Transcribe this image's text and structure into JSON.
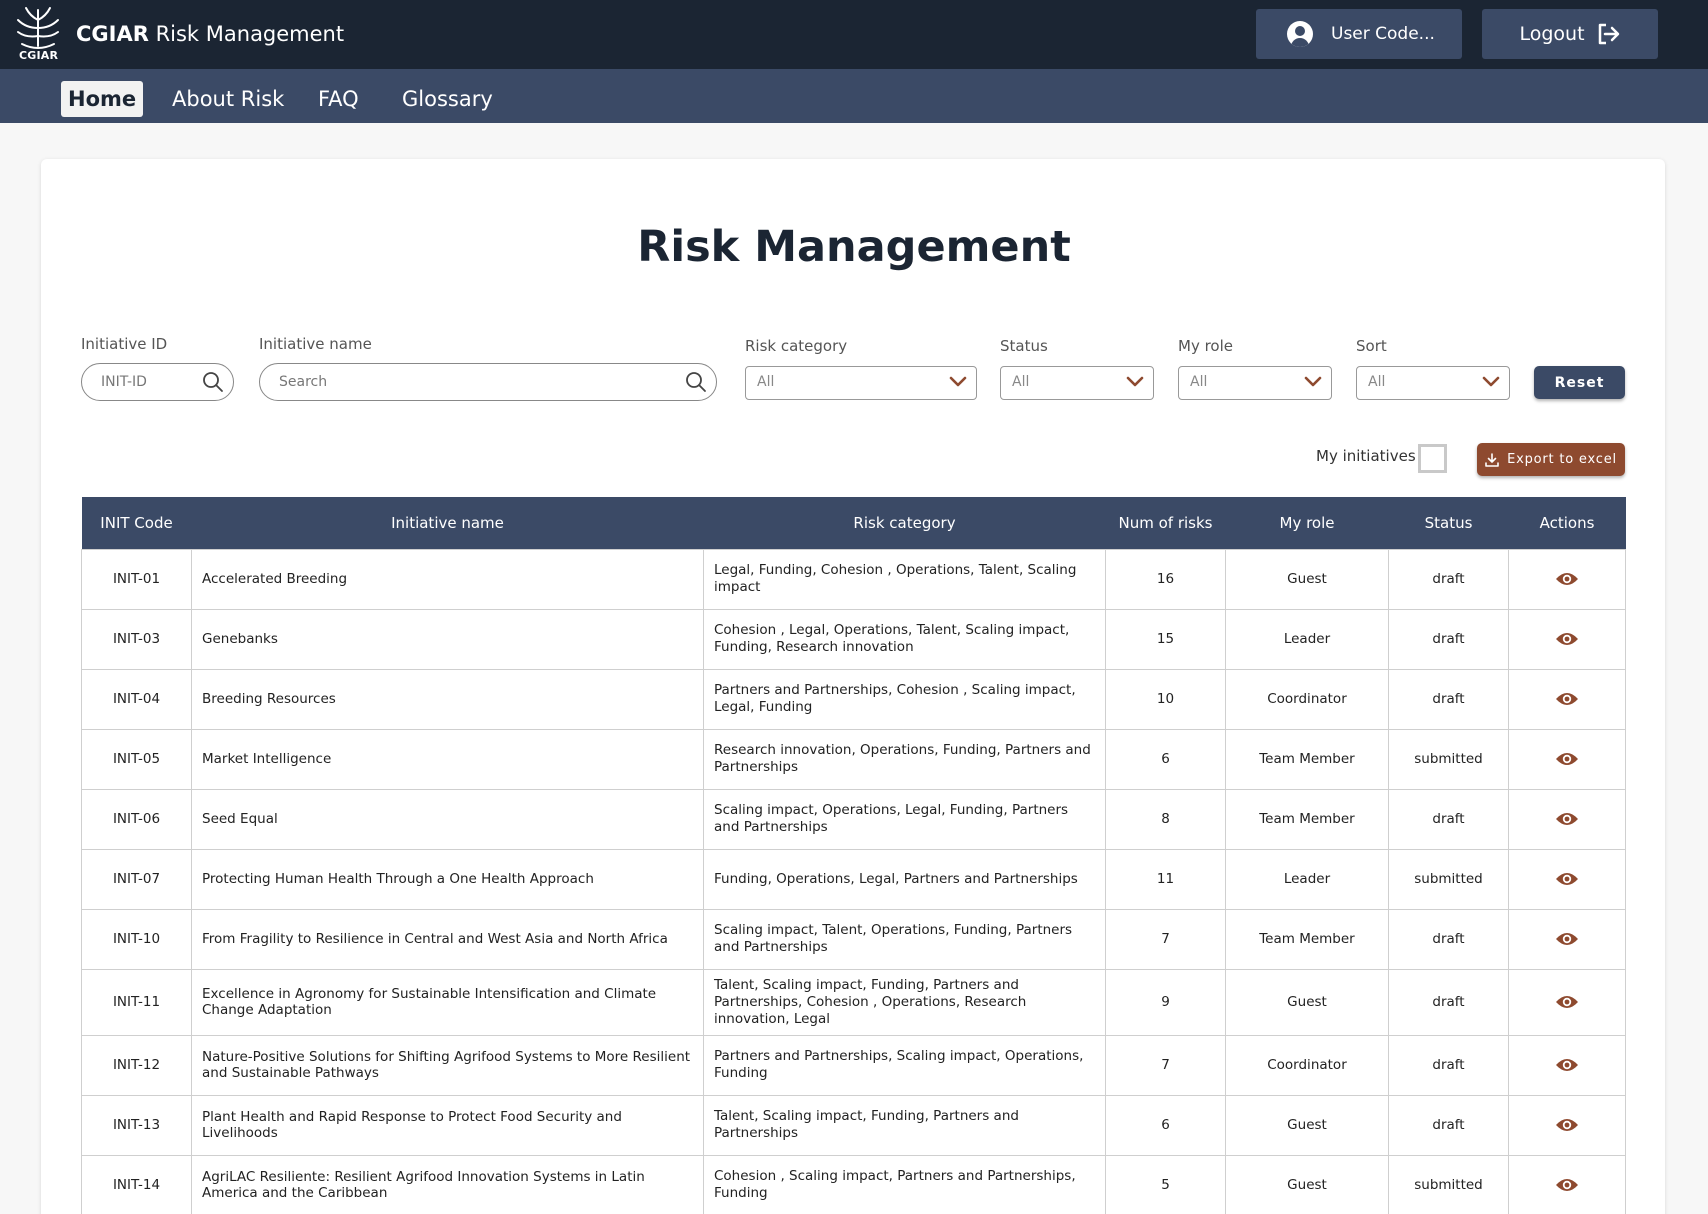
{
  "header": {
    "logo_text": "CGIAR",
    "title_bold": "CGIAR",
    "title_rest": " Risk Management",
    "user_label": "User Code...",
    "logout_label": "Logout"
  },
  "nav": {
    "items": [
      {
        "label": "Home",
        "active": true
      },
      {
        "label": "About Risk",
        "active": false
      },
      {
        "label": "FAQ",
        "active": false
      },
      {
        "label": "Glossary",
        "active": false
      }
    ]
  },
  "page": {
    "title": "Risk Management"
  },
  "filters": {
    "initiative_id": {
      "label": "Initiative ID",
      "placeholder": "INIT-ID"
    },
    "initiative_name": {
      "label": "Initiative name",
      "placeholder": "Search"
    },
    "risk_category": {
      "label": "Risk category",
      "value": "All"
    },
    "status": {
      "label": "Status",
      "value": "All"
    },
    "my_role": {
      "label": "My role",
      "value": "All"
    },
    "sort": {
      "label": "Sort",
      "value": "All"
    },
    "reset_label": "Reset",
    "my_initiatives_label": "My initiatives",
    "export_label": "Export to excel"
  },
  "table": {
    "headers": [
      "INIT Code",
      "Initiative name",
      "Risk category",
      "Num of risks",
      "My role",
      "Status",
      "Actions"
    ],
    "rows": [
      {
        "code": "INIT-01",
        "name": "Accelerated Breeding",
        "risk": "Legal, Funding, Cohesion , Operations, Talent, Scaling impact",
        "num": "16",
        "role": "Guest",
        "status": "draft"
      },
      {
        "code": "INIT-03",
        "name": "Genebanks",
        "risk": "Cohesion , Legal, Operations, Talent, Scaling impact, Funding, Research innovation",
        "num": "15",
        "role": "Leader",
        "status": "draft"
      },
      {
        "code": "INIT-04",
        "name": "Breeding Resources",
        "risk": "Partners and Partnerships, Cohesion , Scaling impact, Legal, Funding",
        "num": "10",
        "role": "Coordinator",
        "status": "draft"
      },
      {
        "code": "INIT-05",
        "name": "Market Intelligence",
        "risk": "Research innovation, Operations, Funding, Partners and Partnerships",
        "num": "6",
        "role": "Team Member",
        "status": "submitted"
      },
      {
        "code": "INIT-06",
        "name": "Seed Equal",
        "risk": "Scaling impact, Operations, Legal, Funding, Partners and Partnerships",
        "num": "8",
        "role": "Team Member",
        "status": "draft"
      },
      {
        "code": "INIT-07",
        "name": "Protecting Human Health Through a One Health Approach",
        "risk": "Funding, Operations, Legal, Partners and Partnerships",
        "num": "11",
        "role": "Leader",
        "status": "submitted"
      },
      {
        "code": "INIT-10",
        "name": "From Fragility to Resilience in Central and West Asia and North Africa",
        "risk": "Scaling impact, Talent, Operations, Funding, Partners and Partnerships",
        "num": "7",
        "role": "Team Member",
        "status": "draft"
      },
      {
        "code": "INIT-11",
        "name": "Excellence in Agronomy for Sustainable Intensification and Climate Change Adaptation",
        "risk": "Talent, Scaling impact, Funding, Partners and Partnerships, Cohesion , Operations, Research innovation, Legal",
        "num": "9",
        "role": "Guest",
        "status": "draft"
      },
      {
        "code": "INIT-12",
        "name": "Nature-Positive Solutions for Shifting Agrifood Systems to More Resilient and Sustainable Pathways",
        "risk": "Partners and Partnerships, Scaling impact, Operations, Funding",
        "num": "7",
        "role": "Coordinator",
        "status": "draft"
      },
      {
        "code": "INIT-13",
        "name": "Plant Health and Rapid Response to Protect Food Security and Livelihoods",
        "risk": "Talent, Scaling impact, Funding, Partners and Partnerships",
        "num": "6",
        "role": "Guest",
        "status": "draft"
      },
      {
        "code": "INIT-14",
        "name": "AgriLAC Resiliente: Resilient Agrifood Innovation Systems in Latin America and the Caribbean",
        "risk": "Cohesion , Scaling impact, Partners and Partnerships, Funding",
        "num": "5",
        "role": "Guest",
        "status": "submitted"
      }
    ]
  },
  "colors": {
    "topbar": "#1b2533",
    "navbar": "#3b4a66",
    "export": "#8e4a2f",
    "eye_icon": "#8e4a2f"
  }
}
